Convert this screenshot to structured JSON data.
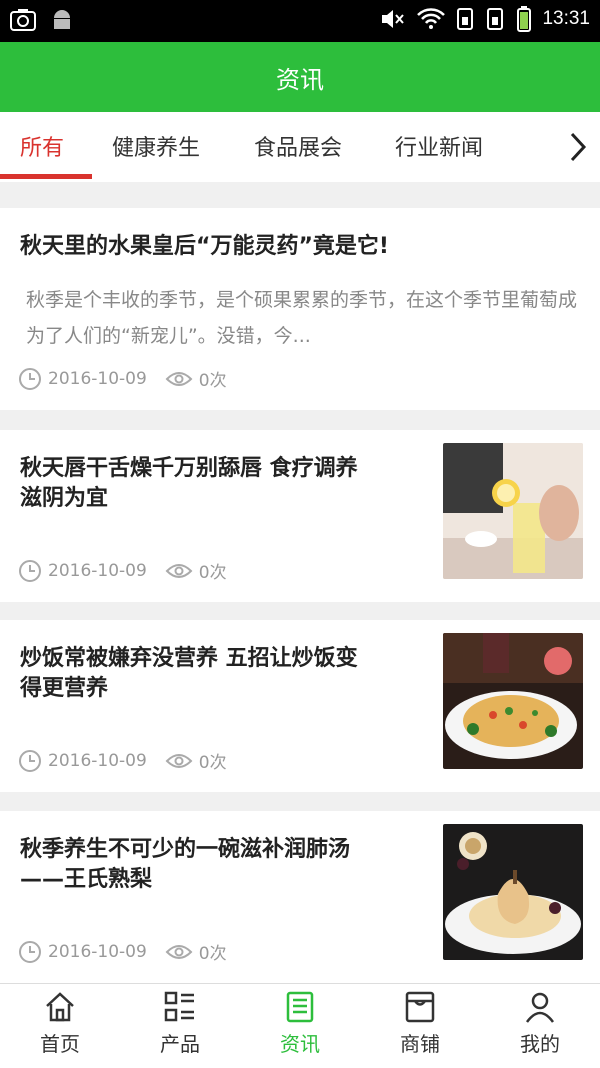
{
  "status": {
    "time": "13:31"
  },
  "appbar": {
    "title": "资讯"
  },
  "tabs": [
    {
      "label": "所有"
    },
    {
      "label": "健康养生"
    },
    {
      "label": "食品展会"
    },
    {
      "label": "行业新闻"
    }
  ],
  "articles": [
    {
      "title": "秋天里的水果皇后“万能灵药”竟是它!",
      "desc": "秋季是个丰收的季节，是个硕果累累的季节，在这个季节里葡萄成为了人们的“新宠儿”。没错，今...",
      "date": "2016-10-09",
      "views": "0次"
    },
    {
      "title_line1": "秋天唇干舌燥千万别舔唇 食疗调养",
      "title_line2": "滋阴为宜",
      "date": "2016-10-09",
      "views": "0次"
    },
    {
      "title_line1": "炒饭常被嫌弃没营养 五招让炒饭变",
      "title_line2": "得更营养",
      "date": "2016-10-09",
      "views": "0次"
    },
    {
      "title_line1": "秋季养生不可少的一碗滋补润肺汤",
      "title_line2": "——王氏熟梨",
      "date": "2016-10-09",
      "views": "0次"
    }
  ],
  "nav": [
    {
      "label": "首页",
      "icon": "home-icon"
    },
    {
      "label": "产品",
      "icon": "grid-list-icon"
    },
    {
      "label": "资讯",
      "icon": "news-icon"
    },
    {
      "label": "商铺",
      "icon": "store-icon"
    },
    {
      "label": "我的",
      "icon": "user-icon"
    }
  ],
  "colors": {
    "accent": "#2dbe3c",
    "tab_active": "#d9332e"
  }
}
